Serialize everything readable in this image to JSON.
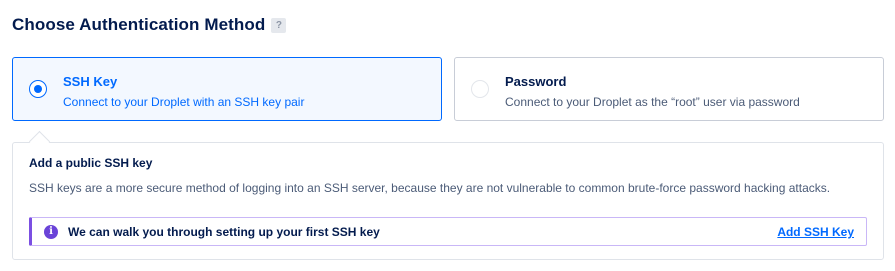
{
  "header": {
    "title": "Choose Authentication Method",
    "help_label": "?"
  },
  "options": [
    {
      "title": "SSH Key",
      "description": "Connect to your Droplet with an SSH key pair",
      "selected": true
    },
    {
      "title": "Password",
      "description": "Connect to your Droplet as the “root” user via password",
      "selected": false
    }
  ],
  "panel": {
    "title": "Add a public SSH key",
    "description": "SSH keys are a more secure method of logging into an SSH server, because they are not vulnerable to common brute-force password hacking attacks.",
    "banner": {
      "icon": "info-icon",
      "icon_glyph": "i",
      "text": "We can walk you through setting up your first SSH key",
      "link_label": "Add SSH Key"
    }
  },
  "colors": {
    "accent": "#0069ff",
    "text_dark": "#031b4e",
    "text_muted": "#4b5b77",
    "banner_accent": "#7b4fe2"
  }
}
